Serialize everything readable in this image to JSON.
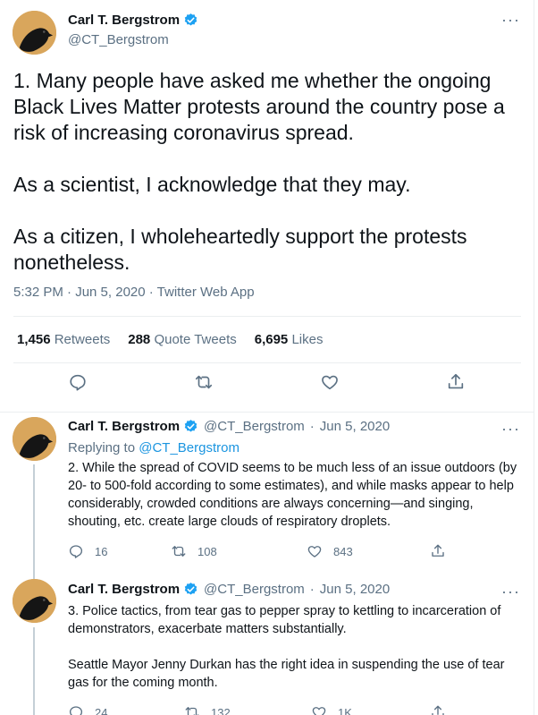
{
  "main_tweet": {
    "author_name": "Carl T. Bergstrom",
    "author_handle": "@CT_Bergstrom",
    "more_icon": "more-horizontal-icon",
    "text": "1. Many people have asked me whether the ongoing Black Lives Matter protests around the country pose a risk of increasing coronavirus spread.\n\nAs a scientist, I acknowledge that they may.\n\nAs a citizen, I wholeheartedly support the protests nonetheless.",
    "timestamp": "5:32 PM · Jun 5, 2020 · Twitter Web App",
    "stats": {
      "retweets_count": "1,456",
      "retweets_label": "Retweets",
      "quotes_count": "288",
      "quotes_label": "Quote Tweets",
      "likes_count": "6,695",
      "likes_label": "Likes"
    },
    "actions": [
      "reply-icon",
      "retweet-icon",
      "like-icon",
      "share-icon"
    ]
  },
  "replies": [
    {
      "author_name": "Carl T. Bergstrom",
      "author_handle": "@CT_Bergstrom",
      "dot": "·",
      "date": "Jun 5, 2020",
      "replying_prefix": "Replying to",
      "replying_to": "@CT_Bergstrom",
      "text": "2. While the spread of COVID seems to be much less of an issue outdoors (by 20- to 500-fold according to some estimates), and while masks appear to help considerably, crowded conditions are always concerning—and singing, shouting, etc. create large clouds of respiratory droplets.",
      "reply_count": "16",
      "retweet_count": "108",
      "like_count": "843"
    },
    {
      "author_name": "Carl T. Bergstrom",
      "author_handle": "@CT_Bergstrom",
      "dot": "·",
      "date": "Jun 5, 2020",
      "text": "3. Police tactics, from tear gas to pepper spray to kettling to incarceration of demonstrators, exacerbate matters substantially.\n\nSeattle Mayor Jenny Durkan has the right idea in suspending the use of tear gas for the coming month.",
      "reply_count": "24",
      "retweet_count": "132",
      "like_count": "1K"
    }
  ],
  "colors": {
    "verified_blue": "#1da1f2",
    "link_blue": "#1b95e0",
    "secondary_text": "#5b7083",
    "divider": "#ebeef0"
  }
}
